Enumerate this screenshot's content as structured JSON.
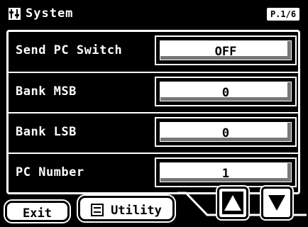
{
  "header": {
    "icon": "tools-icon",
    "title": "System",
    "page_indicator": "P.1/6"
  },
  "settings": [
    {
      "label": "Send PC Switch",
      "value": "OFF"
    },
    {
      "label": "Bank MSB",
      "value": "0"
    },
    {
      "label": "Bank LSB",
      "value": "0"
    },
    {
      "label": "PC Number",
      "value": "1"
    }
  ],
  "footer": {
    "exit_label": "Exit",
    "utility_label": "Utility",
    "utility_icon": "list-icon",
    "up_icon": "arrow-up-icon",
    "down_icon": "arrow-down-icon"
  }
}
